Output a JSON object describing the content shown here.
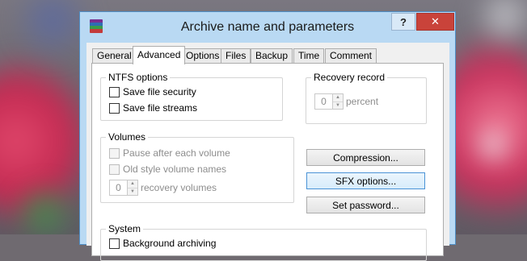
{
  "window": {
    "title": "Archive name and parameters",
    "app_icon": "winrar-books-icon",
    "help_label": "?",
    "close_label": "✕"
  },
  "tabs": [
    {
      "label": "General"
    },
    {
      "label": "Advanced",
      "active": true
    },
    {
      "label": "Options"
    },
    {
      "label": "Files"
    },
    {
      "label": "Backup"
    },
    {
      "label": "Time"
    },
    {
      "label": "Comment"
    }
  ],
  "ntfs": {
    "title": "NTFS options",
    "save_security": {
      "label": "Save file security",
      "checked": false
    },
    "save_streams": {
      "label": "Save file streams",
      "checked": false
    }
  },
  "recovery": {
    "title": "Recovery record",
    "value": "0",
    "unit": "percent"
  },
  "volumes": {
    "title": "Volumes",
    "pause": {
      "label": "Pause after each volume",
      "checked": false,
      "enabled": false
    },
    "old_style": {
      "label": "Old style volume names",
      "checked": false,
      "enabled": false
    },
    "recovery_value": "0",
    "recovery_label": "recovery volumes"
  },
  "buttons": {
    "compression": "Compression...",
    "sfx": "SFX options...",
    "password": "Set password..."
  },
  "system": {
    "title": "System",
    "background": {
      "label": "Background archiving",
      "checked": false
    }
  },
  "colors": {
    "title_bar": "#b9d9f3",
    "close_button": "#c9433a",
    "focus_border": "#4a93d6"
  }
}
